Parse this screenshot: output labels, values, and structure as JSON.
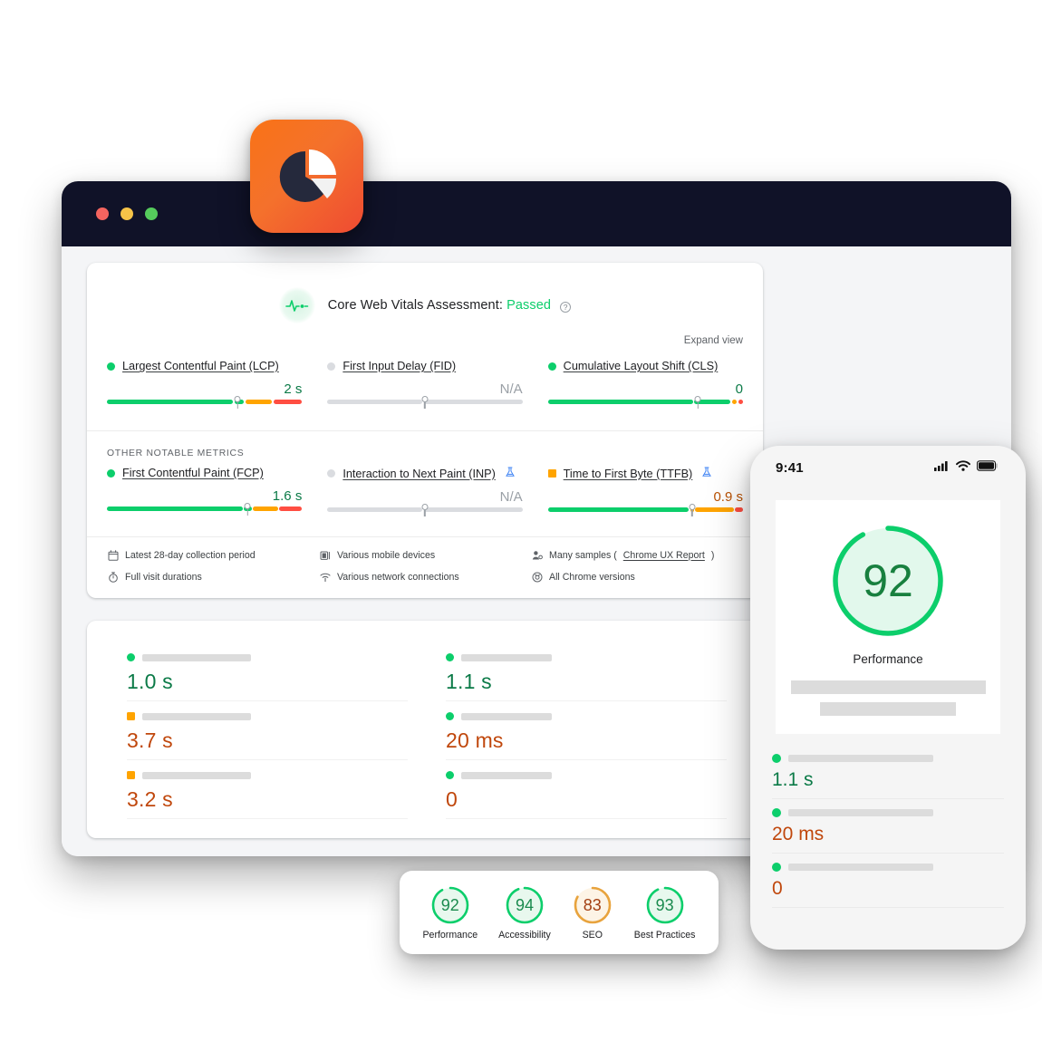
{
  "browser": {
    "traffic_lights": [
      "close",
      "minimize",
      "maximize"
    ]
  },
  "app_icon": {
    "name": "pagespeed-insights-logo"
  },
  "crux": {
    "assessment_prefix": "Core Web Vitals Assessment: ",
    "assessment_status": "Passed",
    "expand_link": "Expand view",
    "other_metrics_label": "OTHER NOTABLE METRICS",
    "core_metrics": [
      {
        "name": "Largest Contentful Paint (LCP)",
        "value": "2 s",
        "status": "good",
        "dot_shape": "circle",
        "value_color": "#0b7a47",
        "marker_pct": 67,
        "experimental": false,
        "segments": [
          {
            "color": "#0cce6b",
            "flex": 66
          },
          {
            "color": "#0cce6b",
            "flex": 5
          },
          {
            "color": "#ffa400",
            "flex": 14
          },
          {
            "color": "#ff4e42",
            "flex": 15
          }
        ]
      },
      {
        "name": "First Input Delay (FID)",
        "value": "N/A",
        "status": "none",
        "dot_shape": "circle",
        "value_color": "#9aa0a6",
        "marker_pct": 50,
        "experimental": false,
        "segments": [
          {
            "color": "#dadce0",
            "flex": 49
          },
          {
            "color": "#dadce0",
            "flex": 51
          }
        ]
      },
      {
        "name": "Cumulative Layout Shift (CLS)",
        "value": "0",
        "status": "good",
        "dot_shape": "circle",
        "value_color": "#0b7a47",
        "marker_pct": 77,
        "experimental": false,
        "segments": [
          {
            "color": "#0cce6b",
            "flex": 76
          },
          {
            "color": "#0cce6b",
            "flex": 19
          },
          {
            "color": "#ffa400",
            "flex": 2.5
          },
          {
            "color": "#ff4e42",
            "flex": 2.5
          }
        ]
      }
    ],
    "other_metrics": [
      {
        "name": "First Contentful Paint (FCP)",
        "value": "1.6 s",
        "status": "good",
        "dot_shape": "circle",
        "value_color": "#0b7a47",
        "marker_pct": 72,
        "experimental": false,
        "segments": [
          {
            "color": "#0cce6b",
            "flex": 71
          },
          {
            "color": "#0cce6b",
            "flex": 4
          },
          {
            "color": "#ffa400",
            "flex": 13
          },
          {
            "color": "#ff4e42",
            "flex": 12
          }
        ]
      },
      {
        "name": "Interaction to Next Paint (INP)",
        "value": "N/A",
        "status": "none",
        "dot_shape": "circle",
        "value_color": "#9aa0a6",
        "marker_pct": 50,
        "experimental": true,
        "segments": [
          {
            "color": "#dadce0",
            "flex": 49
          },
          {
            "color": "#dadce0",
            "flex": 51
          }
        ]
      },
      {
        "name": "Time to First Byte (TTFB)",
        "value": "0.9 s",
        "status": "needs-improvement",
        "dot_shape": "square",
        "value_color": "#b95000",
        "marker_pct": 74,
        "experimental": true,
        "segments": [
          {
            "color": "#0cce6b",
            "flex": 73
          },
          {
            "color": "#ffa400",
            "flex": 2
          },
          {
            "color": "#ffa400",
            "flex": 20
          },
          {
            "color": "#ff4e42",
            "flex": 4
          }
        ]
      }
    ],
    "meta": [
      {
        "icon": "calendar-icon",
        "text": "Latest 28-day collection period",
        "link": null
      },
      {
        "icon": "mobile-device-icon",
        "text": "Various mobile devices",
        "link": null
      },
      {
        "icon": "samples-icon",
        "text": "Many samples (",
        "link": "Chrome UX Report",
        "suffix": ")"
      },
      {
        "icon": "stopwatch-icon",
        "text": "Full visit durations",
        "link": null
      },
      {
        "icon": "wifi-icon",
        "text": "Various network connections",
        "link": null
      },
      {
        "icon": "chrome-icon",
        "text": "All Chrome versions",
        "link": null
      }
    ]
  },
  "lab": {
    "left_column": [
      {
        "value": "1.0 s",
        "status": "good",
        "dot_shape": "circle",
        "dot_color": "#0cce6b",
        "value_color": "#0b7a47",
        "skeleton_width": 120
      },
      {
        "value": "3.7 s",
        "status": "needs-improvement",
        "dot_shape": "square",
        "dot_color": "#ffa400",
        "value_color": "#c0470c",
        "skeleton_width": 120
      },
      {
        "value": "3.2 s",
        "status": "needs-improvement",
        "dot_shape": "square",
        "dot_color": "#ffa400",
        "value_color": "#c0470c",
        "skeleton_width": 120
      }
    ],
    "right_column": [
      {
        "value": "1.1 s",
        "status": "good",
        "dot_shape": "circle",
        "dot_color": "#0cce6b",
        "value_color": "#0b7a47",
        "skeleton_width": 100
      },
      {
        "value": "20 ms",
        "status": "good",
        "dot_shape": "circle",
        "dot_color": "#0cce6b",
        "value_color": "#c0470c",
        "skeleton_width": 100
      },
      {
        "value": "0",
        "status": "good",
        "dot_shape": "circle",
        "dot_color": "#0cce6b",
        "value_color": "#c0470c",
        "skeleton_width": 100
      }
    ]
  },
  "phone": {
    "clock": "9:41",
    "status_icons": [
      "cellular-signal-icon",
      "wifi-icon",
      "battery-icon"
    ],
    "gauge": {
      "score": "92",
      "label": "Performance",
      "color": "#0cce6b",
      "fill": "#e2f8ec"
    },
    "metrics": [
      {
        "value": "1.1 s",
        "dot_color": "#0cce6b",
        "value_color": "#0b7a47"
      },
      {
        "value": "20 ms",
        "dot_color": "#0cce6b",
        "value_color": "#c0470c"
      },
      {
        "value": "0",
        "dot_color": "#0cce6b",
        "value_color": "#c0470c"
      }
    ]
  },
  "scores": [
    {
      "value": "92",
      "label": "Performance",
      "color": "#0cce6b",
      "fill": "#e8f8ee",
      "num_color": "#1a8a4e",
      "pct": 92
    },
    {
      "value": "94",
      "label": "Accessibility",
      "color": "#0cce6b",
      "fill": "#e8f8ee",
      "num_color": "#1a8a4e",
      "pct": 94
    },
    {
      "value": "83",
      "label": "SEO",
      "color": "#e8a33d",
      "fill": "#fdf4e6",
      "num_color": "#a33f12",
      "pct": 83
    },
    {
      "value": "93",
      "label": "Best Practices",
      "color": "#0cce6b",
      "fill": "#e8f8ee",
      "num_color": "#1a8a4e",
      "pct": 93
    }
  ],
  "colors": {
    "good": "#0cce6b",
    "needs_improvement": "#ffa400",
    "poor": "#ff4e42",
    "neutral": "#dadce0",
    "brand_orange": "#f97316",
    "titlebar": "#101228"
  }
}
